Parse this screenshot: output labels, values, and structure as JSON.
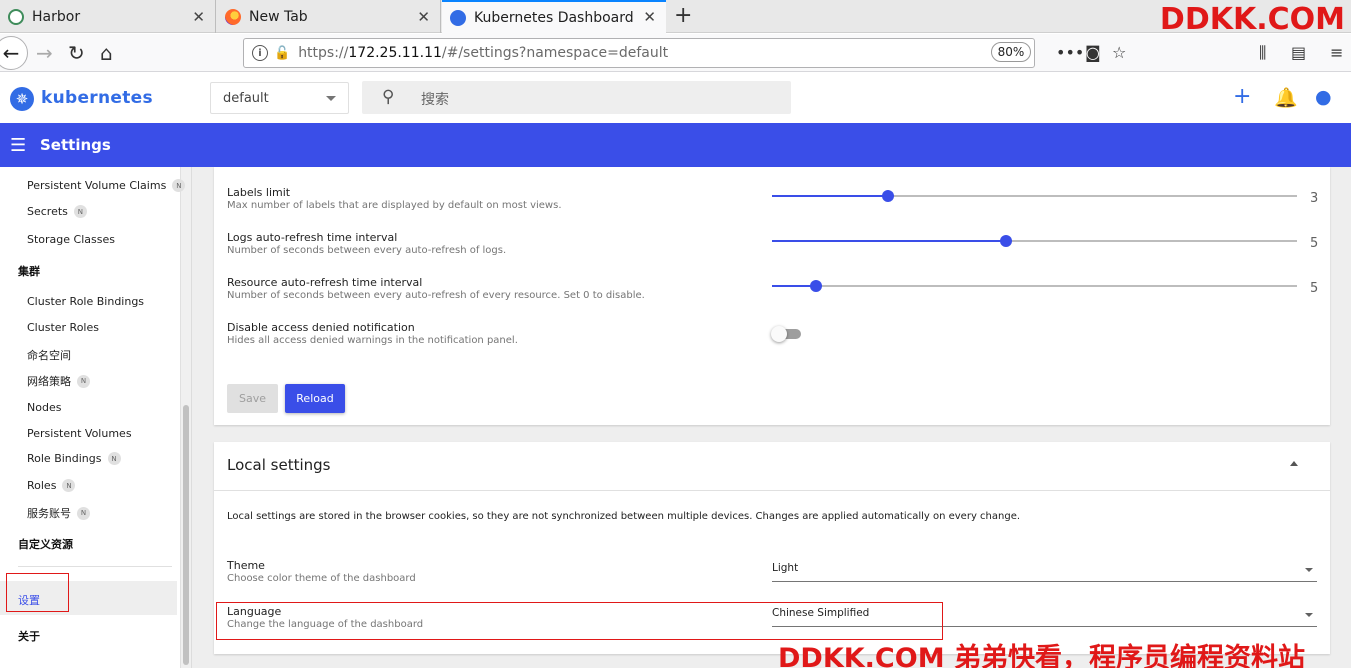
{
  "browser": {
    "tabs": [
      {
        "label": "Harbor"
      },
      {
        "label": "New Tab"
      },
      {
        "label": "Kubernetes Dashboard"
      }
    ],
    "url_prefix": "https://",
    "url_host": "172.25.11.11",
    "url_path": "/#/settings?namespace=default",
    "zoom": "80%"
  },
  "watermark": {
    "top": "DDKK.COM",
    "bottom": "DDKK.COM 弟弟快看，程序员编程资料站"
  },
  "app": {
    "brand": "kubernetes",
    "namespace": "default",
    "search_placeholder": "搜索",
    "page_title": "Settings",
    "accent": "#3a4ee8"
  },
  "sidebar": {
    "items_top": [
      {
        "label": "Persistent Volume Claims",
        "badge": "N"
      },
      {
        "label": "Secrets",
        "badge": "N"
      },
      {
        "label": "Storage Classes",
        "badge": ""
      }
    ],
    "cluster_heading": "集群",
    "cluster_items": [
      {
        "label": "Cluster Role Bindings",
        "badge": ""
      },
      {
        "label": "Cluster Roles",
        "badge": ""
      },
      {
        "label": "命名空间",
        "badge": ""
      },
      {
        "label": "网络策略",
        "badge": "N"
      },
      {
        "label": "Nodes",
        "badge": ""
      },
      {
        "label": "Persistent Volumes",
        "badge": ""
      },
      {
        "label": "Role Bindings",
        "badge": "N"
      },
      {
        "label": "Roles",
        "badge": "N"
      },
      {
        "label": "服务账号",
        "badge": "N"
      }
    ],
    "crd_heading": "自定义资源",
    "settings": "设置",
    "about": "关于"
  },
  "global_settings": {
    "labels_limit": {
      "label": "Labels limit",
      "desc": "Max number of labels that are displayed by default on most views.",
      "value": "3",
      "fraction": 0.22
    },
    "logs_refresh": {
      "label": "Logs auto-refresh time interval",
      "desc": "Number of seconds between every auto-refresh of logs.",
      "value": "5",
      "fraction": 0.445
    },
    "resource_refresh": {
      "label": "Resource auto-refresh time interval",
      "desc": "Number of seconds between every auto-refresh of every resource. Set 0 to disable.",
      "value": "5",
      "fraction": 0.083
    },
    "disable_denied": {
      "label": "Disable access denied notification",
      "desc": "Hides all access denied warnings in the notification panel.",
      "enabled": false
    },
    "save_label": "Save",
    "reload_label": "Reload"
  },
  "local_settings": {
    "title": "Local settings",
    "description": "Local settings are stored in the browser cookies, so they are not synchronized between multiple devices. Changes are applied automatically on every change.",
    "theme": {
      "label": "Theme",
      "desc": "Choose color theme of the dashboard",
      "value": "Light"
    },
    "language": {
      "label": "Language",
      "desc": "Change the language of the dashboard",
      "value": "Chinese Simplified"
    }
  }
}
